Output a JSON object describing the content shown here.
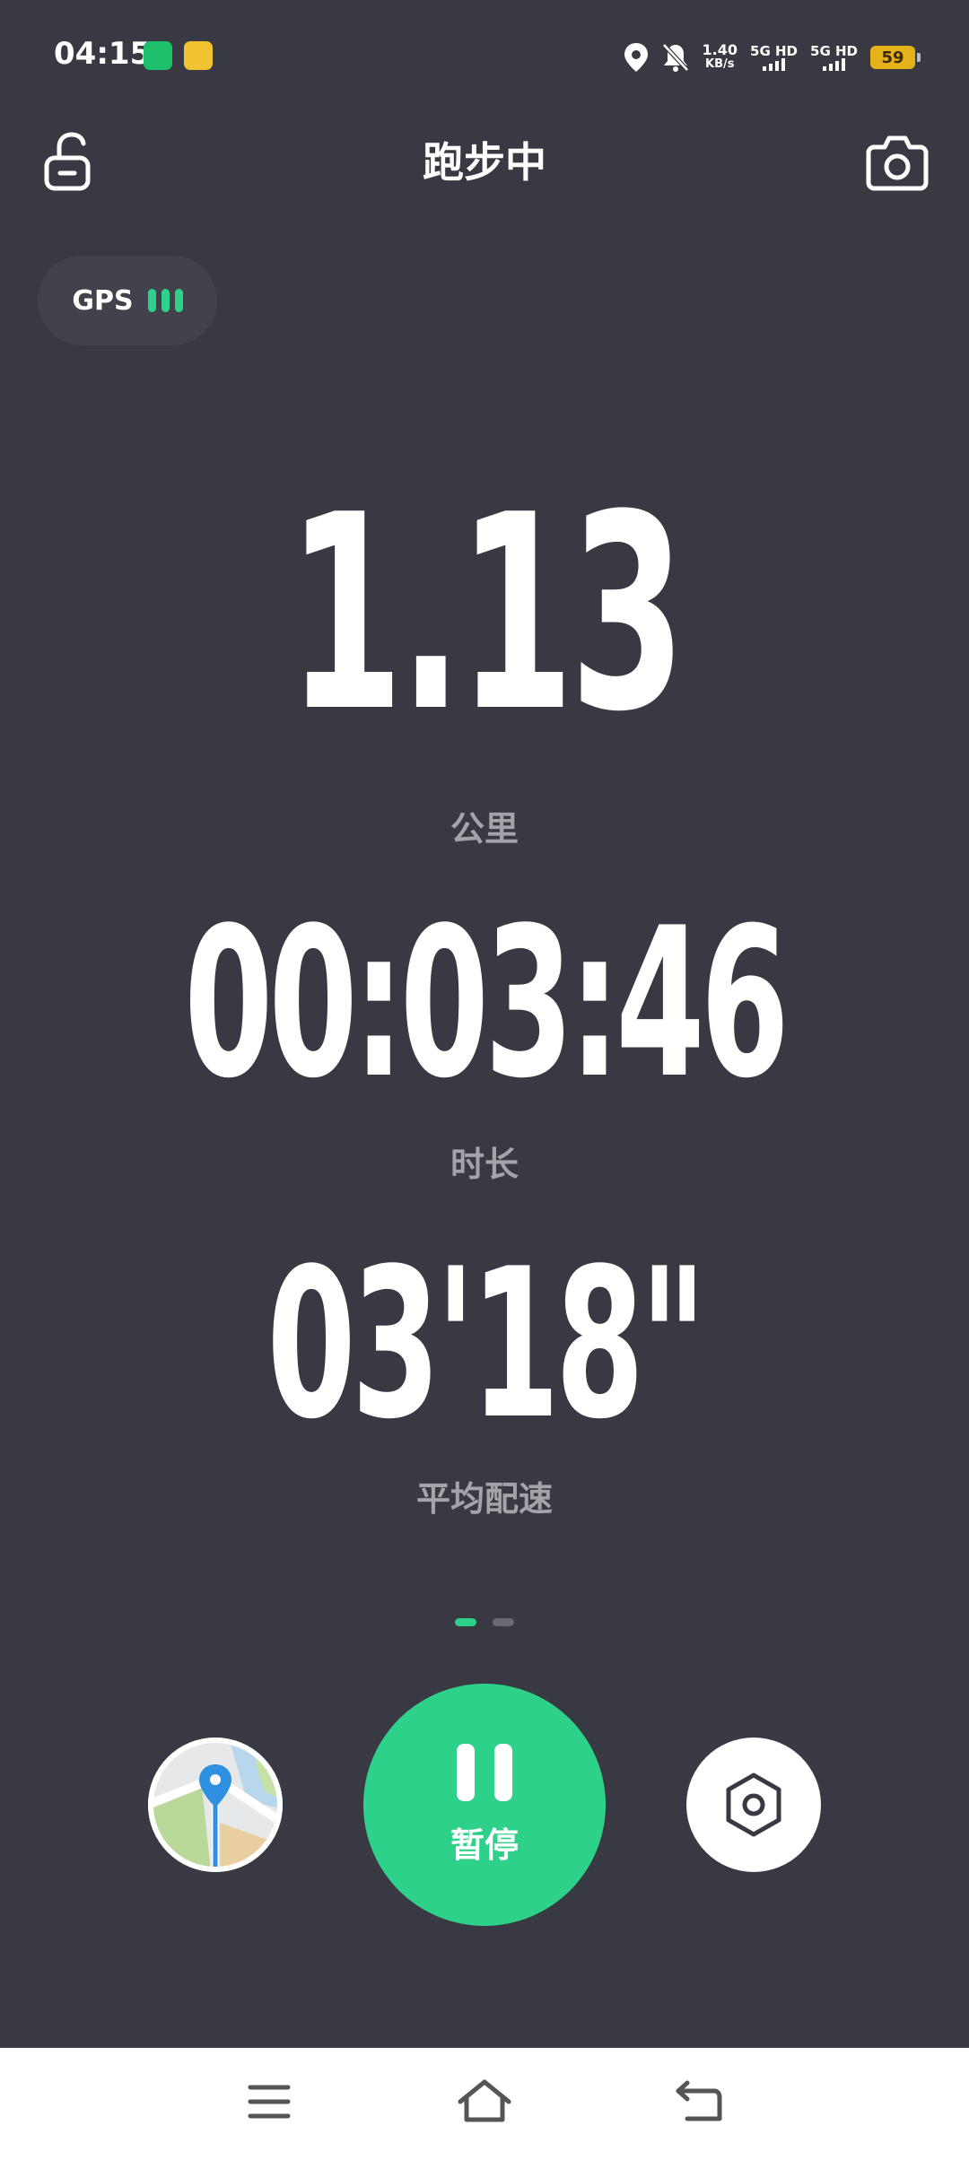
{
  "status_bar": {
    "time": "04:15",
    "net_speed_value": "1.40",
    "net_speed_unit": "KB/s",
    "sim1_label": "5G HD",
    "sim2_label": "5G HD",
    "battery_level": "59",
    "icons": [
      "app-notification-icon",
      "game-notification-icon",
      "location-icon",
      "mute-bell-icon",
      "signal-icon",
      "battery-icon"
    ]
  },
  "header": {
    "title": "跑步中",
    "left_icon": "unlock-icon",
    "right_icon": "camera-icon"
  },
  "gps": {
    "label": "GPS",
    "signal_bars": 3,
    "signal_color": "#2ed18a"
  },
  "metrics": {
    "distance": {
      "value": "1.13",
      "label": "公里"
    },
    "duration": {
      "value": "00:03:46",
      "label": "时长"
    },
    "pace": {
      "value": "03'18\"",
      "label": "平均配速"
    }
  },
  "pager": {
    "pages": 2,
    "active": 1
  },
  "controls": {
    "map_icon": "map-icon",
    "pause_label": "暂停",
    "pause_icon": "pause-icon",
    "settings_icon": "settings-icon",
    "accent": "#2ed18a"
  },
  "nav_bar": {
    "icons": [
      "menu-icon",
      "home-icon",
      "back-icon"
    ]
  },
  "colors": {
    "background": "#393944",
    "label": "#a3a3aa",
    "accent": "#2ed18a"
  }
}
